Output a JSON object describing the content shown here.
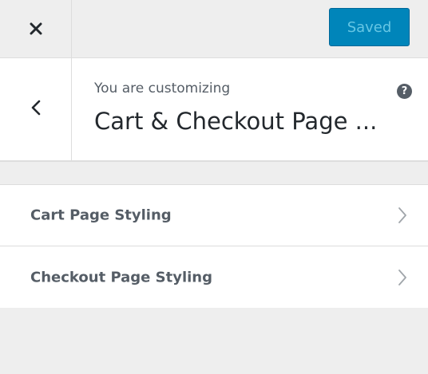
{
  "header": {
    "close_icon": "close-icon",
    "saved_label": "Saved",
    "saved_bg": "#0085ba"
  },
  "customize": {
    "back_icon": "chevron-left-icon",
    "customizing_label": "You are customizing",
    "title": "Cart & Checkout Page ...",
    "help_icon": "question-circle-icon",
    "help_glyph": "?"
  },
  "sections": [
    {
      "label": "Cart Page Styling",
      "icon": "chevron-right-icon"
    },
    {
      "label": "Checkout Page Styling",
      "icon": "chevron-right-icon"
    }
  ]
}
